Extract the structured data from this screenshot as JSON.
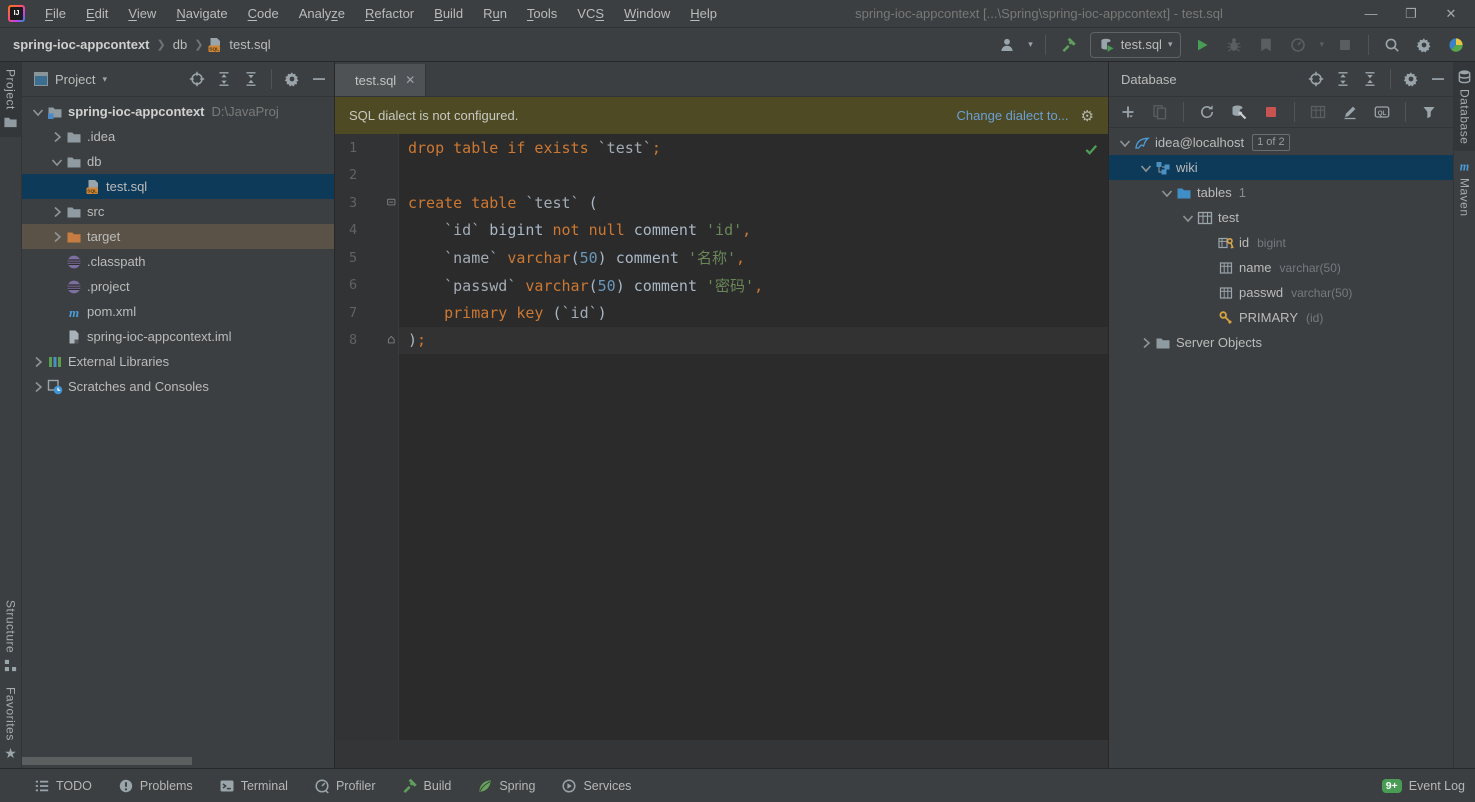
{
  "window": {
    "title": "spring-ioc-appcontext [...\\Spring\\spring-ioc-appcontext] - test.sql",
    "menus": [
      {
        "label": "File",
        "u": 0
      },
      {
        "label": "Edit",
        "u": 0
      },
      {
        "label": "View",
        "u": 0
      },
      {
        "label": "Navigate",
        "u": 0
      },
      {
        "label": "Code",
        "u": 0
      },
      {
        "label": "Analyze",
        "u": 5
      },
      {
        "label": "Refactor",
        "u": 0
      },
      {
        "label": "Build",
        "u": 0
      },
      {
        "label": "Run",
        "u": 1
      },
      {
        "label": "Tools",
        "u": 0
      },
      {
        "label": "VCS",
        "u": 2
      },
      {
        "label": "Window",
        "u": 0
      },
      {
        "label": "Help",
        "u": 0
      }
    ],
    "controls": {
      "minimize": "—",
      "maximize": "❐",
      "close": "✕"
    }
  },
  "navbar": {
    "breadcrumbs": [
      {
        "label": "spring-ioc-appcontext",
        "bold": true
      },
      {
        "label": "db"
      },
      {
        "label": "test.sql",
        "icon": "sql-file"
      }
    ],
    "right_tools": [
      {
        "icon": "user",
        "name": "user-icon"
      },
      {
        "icon": "caret",
        "name": "caret-down-icon"
      },
      {
        "icon": "sep"
      },
      {
        "icon": "hammer",
        "name": "build-hammer-icon"
      },
      {
        "icon": "runpill"
      },
      {
        "icon": "play",
        "name": "run-icon"
      },
      {
        "icon": "bug",
        "name": "debug-icon",
        "dim": true
      },
      {
        "icon": "coverage",
        "name": "coverage-icon",
        "dim": true
      },
      {
        "icon": "profiler",
        "name": "profiler-icon",
        "dim": true
      },
      {
        "icon": "caret",
        "name": "caret-down-icon",
        "dim": true
      },
      {
        "icon": "stopdim",
        "name": "stop-icon",
        "dim": true
      },
      {
        "icon": "sep"
      },
      {
        "icon": "search",
        "name": "search-icon"
      },
      {
        "icon": "gear",
        "name": "settings-gear-icon"
      },
      {
        "icon": "colorball",
        "name": "ide-sphere-icon"
      }
    ],
    "run_config": {
      "label": "test.sql"
    }
  },
  "left_stripe": {
    "top": [
      {
        "label": "Project",
        "icon": "folder",
        "active": true
      }
    ],
    "bottom": [
      {
        "label": "Structure",
        "icon": "structure"
      },
      {
        "label": "Favorites",
        "icon": "star"
      }
    ]
  },
  "right_stripe": {
    "top": [
      {
        "label": "Database",
        "icon": "dbstripe",
        "active": true
      },
      {
        "label": "Maven",
        "icon": "maven"
      }
    ]
  },
  "project_panel": {
    "title": "Project",
    "header_icons": [
      "locate",
      "expandall",
      "collapseall",
      "sep",
      "gear",
      "minus"
    ],
    "tree": [
      {
        "chevron": "down",
        "icon": "folder-project",
        "label": "spring-ioc-appcontext",
        "bold": true,
        "extra": "D:\\JavaProj",
        "indent": 0
      },
      {
        "chevron": "right",
        "icon": "folder",
        "label": ".idea",
        "indent": 1
      },
      {
        "chevron": "down",
        "icon": "folder",
        "label": "db",
        "indent": 1
      },
      {
        "icon": "sql-file",
        "label": "test.sql",
        "indent": 2,
        "state": "sel"
      },
      {
        "chevron": "right",
        "icon": "folder",
        "label": "src",
        "indent": 1
      },
      {
        "chevron": "right",
        "icon": "folder-orange",
        "label": "target",
        "indent": 1,
        "state": "warm"
      },
      {
        "icon": "eclipse",
        "label": ".classpath",
        "indent": 1
      },
      {
        "icon": "eclipse",
        "label": ".project",
        "indent": 1
      },
      {
        "icon": "maven",
        "label": "pom.xml",
        "indent": 1
      },
      {
        "icon": "iml",
        "label": "spring-ioc-appcontext.iml",
        "indent": 1
      },
      {
        "chevron": "right",
        "icon": "libs",
        "label": "External Libraries",
        "indent": 0
      },
      {
        "chevron": "right",
        "icon": "scratch",
        "label": "Scratches and Consoles",
        "indent": 0
      }
    ]
  },
  "editor": {
    "tab": {
      "label": "test.sql",
      "icon": "sql-file",
      "close": "✕"
    },
    "banner": {
      "message": "SQL dialect is not configured.",
      "action": "Change dialect to...",
      "gear": "⚙"
    },
    "code": {
      "current_line": 8,
      "lines": [
        {
          "num": 1,
          "tokens": [
            [
              "drop table if exists ",
              "kw"
            ],
            [
              "`test`",
              "id"
            ],
            [
              ";",
              "kw"
            ]
          ]
        },
        {
          "num": 2,
          "tokens": []
        },
        {
          "num": 3,
          "fold": "open",
          "tokens": [
            [
              "create table ",
              "kw"
            ],
            [
              "`test`",
              "id"
            ],
            [
              " (",
              "pl"
            ]
          ]
        },
        {
          "num": 4,
          "tokens": [
            [
              "    ",
              "pl"
            ],
            [
              "`id`",
              "id"
            ],
            [
              " bigint ",
              "pl"
            ],
            [
              "not null",
              "kw"
            ],
            [
              " comment ",
              "pl"
            ],
            [
              "'id'",
              "str"
            ],
            [
              ",",
              "kw"
            ]
          ]
        },
        {
          "num": 5,
          "tokens": [
            [
              "    ",
              "pl"
            ],
            [
              "`name`",
              "id"
            ],
            [
              " ",
              "pl"
            ],
            [
              "varchar",
              "kw"
            ],
            [
              "(",
              "pl"
            ],
            [
              "50",
              "num"
            ],
            [
              ")",
              "pl"
            ],
            [
              " comment ",
              "pl"
            ],
            [
              "'名称'",
              "str"
            ],
            [
              ",",
              "kw"
            ]
          ]
        },
        {
          "num": 6,
          "tokens": [
            [
              "    ",
              "pl"
            ],
            [
              "`passwd`",
              "id"
            ],
            [
              " ",
              "pl"
            ],
            [
              "varchar",
              "kw"
            ],
            [
              "(",
              "pl"
            ],
            [
              "50",
              "num"
            ],
            [
              ")",
              "pl"
            ],
            [
              " comment ",
              "pl"
            ],
            [
              "'密码'",
              "str"
            ],
            [
              ",",
              "kw"
            ]
          ]
        },
        {
          "num": 7,
          "tokens": [
            [
              "    ",
              "pl"
            ],
            [
              "primary key",
              "kw"
            ],
            [
              " (",
              "pl"
            ],
            [
              "`id`",
              "id"
            ],
            [
              ")",
              "pl"
            ]
          ]
        },
        {
          "num": 8,
          "fold": "close",
          "tokens": [
            [
              ")",
              "pl"
            ],
            [
              ";",
              "kw"
            ]
          ]
        }
      ]
    }
  },
  "database_panel": {
    "title": "Database",
    "header_icons": [
      "locate",
      "expandall",
      "collapseall",
      "sep",
      "gear",
      "minus"
    ],
    "toolbar_icons": [
      {
        "icon": "plus",
        "name": "add-datasource-icon"
      },
      {
        "icon": "copy",
        "name": "duplicate-icon",
        "dim": true
      },
      {
        "icon": "sep"
      },
      {
        "icon": "refresh",
        "name": "refresh-icon"
      },
      {
        "icon": "dbwrench",
        "name": "datasource-properties-icon"
      },
      {
        "icon": "stopred",
        "name": "stop-red-icon"
      },
      {
        "icon": "sep"
      },
      {
        "icon": "gridtable",
        "name": "table-view-icon",
        "dim": true
      },
      {
        "icon": "pencil",
        "name": "edit-icon"
      },
      {
        "icon": "ql",
        "name": "jump-to-console-icon"
      },
      {
        "icon": "sep"
      },
      {
        "icon": "filter",
        "name": "filter-icon"
      }
    ],
    "tree": [
      {
        "chevron": "down",
        "icon": "mysql",
        "label": "idea@localhost",
        "badge": "1 of 2",
        "indent": 0
      },
      {
        "chevron": "down",
        "icon": "schema",
        "label": "wiki",
        "indent": 1,
        "state": "sel"
      },
      {
        "chevron": "down",
        "icon": "folder-blue",
        "label": "tables",
        "count": "1",
        "indent": 2
      },
      {
        "chevron": "down",
        "icon": "tablegrid",
        "label": "test",
        "indent": 3
      },
      {
        "icon": "column-key",
        "label": "id",
        "type": "bigint",
        "indent": 4
      },
      {
        "icon": "column",
        "label": "name",
        "type": "varchar(50)",
        "indent": 4
      },
      {
        "icon": "column",
        "label": "passwd",
        "type": "varchar(50)",
        "indent": 4
      },
      {
        "icon": "goldkey",
        "label": "PRIMARY",
        "type": "(id)",
        "indent": 4
      },
      {
        "chevron": "right",
        "icon": "folder",
        "label": "Server Objects",
        "indent": 1
      }
    ]
  },
  "status_bar": {
    "items": [
      {
        "label": "TODO",
        "icon": "todo"
      },
      {
        "label": "Problems",
        "icon": "problems"
      },
      {
        "label": "Terminal",
        "icon": "terminal"
      },
      {
        "label": "Profiler",
        "icon": "profilersb"
      },
      {
        "label": "Build",
        "icon": "hammer"
      },
      {
        "label": "Spring",
        "icon": "spring"
      },
      {
        "label": "Services",
        "icon": "services"
      }
    ],
    "event_log": {
      "badge": "9+",
      "label": "Event Log"
    }
  },
  "colors": {
    "selection_blue": "#0d3a58",
    "warm_row": "#5a5246",
    "banner_olive": "#4d4a24",
    "link_blue": "#6d9fd4",
    "keyword_orange": "#cc7832",
    "string_green": "#6a8759",
    "number_blue": "#6897bb",
    "plain_code": "#a9b7c6",
    "badge_green": "#499c54"
  }
}
